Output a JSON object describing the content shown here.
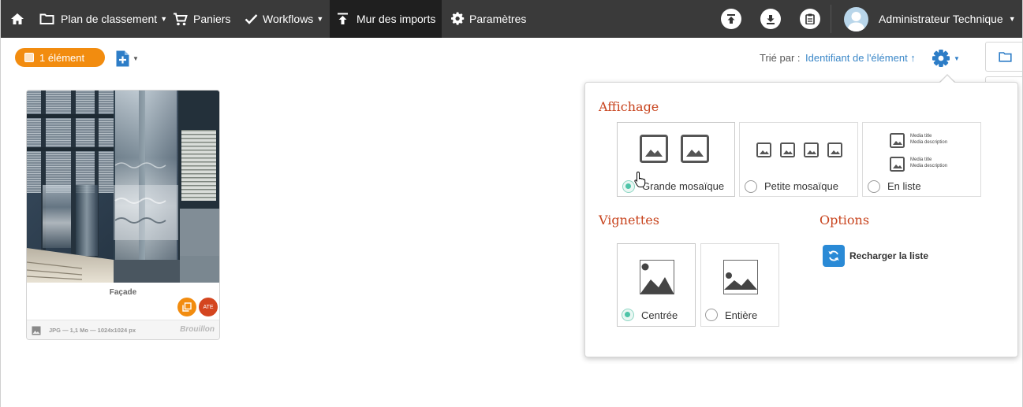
{
  "nav": {
    "home_icon": "home-icon",
    "items": [
      {
        "label": "Plan de classement",
        "icon": "folder-icon",
        "dropdown": true
      },
      {
        "label": "Paniers",
        "icon": "cart-icon",
        "dropdown": false
      },
      {
        "label": "Workflows",
        "icon": "check-icon",
        "dropdown": true
      },
      {
        "label": "Mur des imports",
        "icon": "upload-icon",
        "dropdown": false,
        "active": true
      },
      {
        "label": "Paramètres",
        "icon": "gear-icon",
        "dropdown": false
      }
    ],
    "actions": [
      "upload-circle-icon",
      "download-circle-icon",
      "clipboard-icon"
    ],
    "user": "Administrateur Technique"
  },
  "toolbar": {
    "selection_label": "1 élément",
    "sort_label": "Trié par :",
    "sort_value": "Identifiant de l'élément ↑"
  },
  "card": {
    "title": "Façade",
    "badge_ate": "ATE",
    "meta": "JPG — 1,1 Mo — 1024x1024 px",
    "status": "Brouillon"
  },
  "panel": {
    "display_title": "Affichage",
    "display_options": [
      {
        "label": "Grande mosaïque",
        "selected": true
      },
      {
        "label": "Petite mosaïque",
        "selected": false
      },
      {
        "label": "En liste",
        "selected": false
      }
    ],
    "list_sample": {
      "line1": "Media title",
      "line2": "Media description"
    },
    "thumbs_title": "Vignettes",
    "thumb_options": [
      {
        "label": "Centrée",
        "selected": true
      },
      {
        "label": "Entière",
        "selected": false
      }
    ],
    "options_title": "Options",
    "reload_label": "Recharger la liste"
  },
  "colors": {
    "topbar": "#3a3a3a",
    "accent_orange": "#f28c0f",
    "section_title": "#c8441e",
    "link_blue": "#3a87c8",
    "radio_on": "#4ec4a8"
  }
}
